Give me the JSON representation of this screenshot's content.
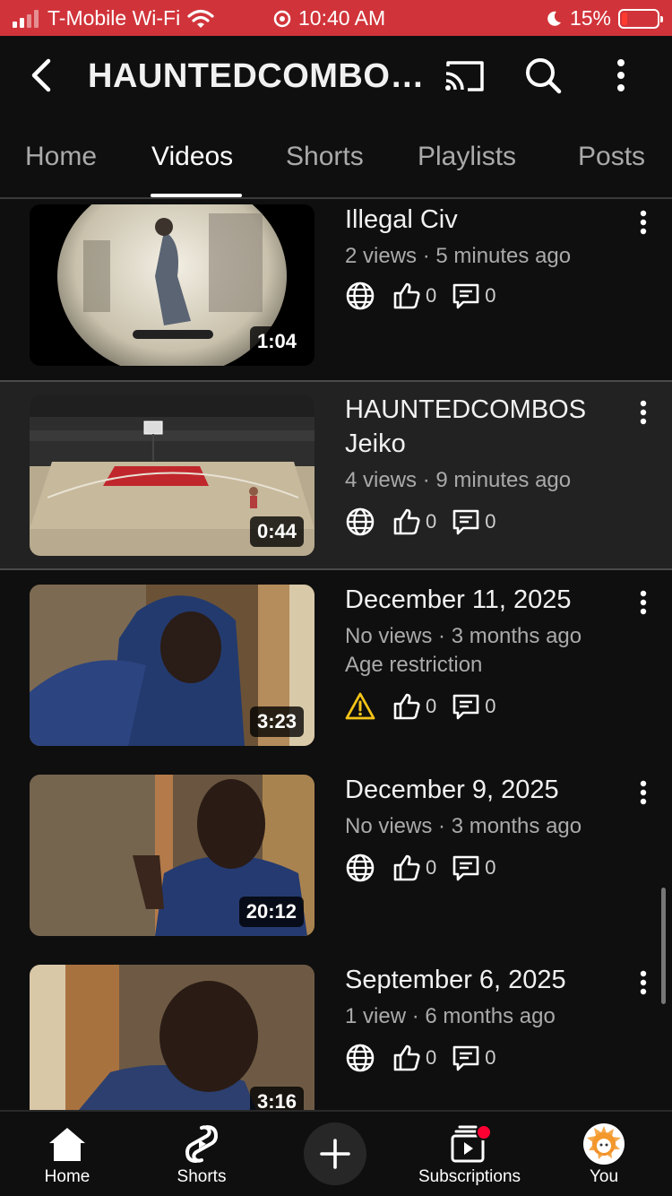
{
  "status_bar": {
    "carrier": "T-Mobile Wi-Fi",
    "time": "10:40 AM",
    "battery": "15%",
    "battery_level": 0.15,
    "bg_color": "#d0343a"
  },
  "appbar": {
    "title": "HAUNTEDCOMBO…",
    "icons": [
      "back-icon",
      "cast-icon",
      "search-icon",
      "more-icon"
    ]
  },
  "tabs": [
    {
      "label": "Home",
      "active": false
    },
    {
      "label": "Videos",
      "active": true
    },
    {
      "label": "Shorts",
      "active": false
    },
    {
      "label": "Playlists",
      "active": false
    },
    {
      "label": "Posts",
      "active": false
    }
  ],
  "videos": [
    {
      "title": "Illegal Civ",
      "meta": "2 views · 5 minutes ago",
      "extra": "",
      "duration": "1:04",
      "visibility": "public",
      "likes": "0",
      "comments": "0"
    },
    {
      "title": "HAUNTEDCOMBOS Jeiko",
      "meta": "4 views · 9 minutes ago",
      "extra": "",
      "duration": "0:44",
      "visibility": "public",
      "likes": "0",
      "comments": "0"
    },
    {
      "title": "December 11, 2025",
      "meta": "No views · 3 months ago",
      "extra": "Age restriction",
      "duration": "3:23",
      "visibility": "warning",
      "likes": "0",
      "comments": "0"
    },
    {
      "title": "December 9, 2025",
      "meta": "No views · 3 months ago",
      "extra": "",
      "duration": "20:12",
      "visibility": "public",
      "likes": "0",
      "comments": "0"
    },
    {
      "title": "September 6, 2025",
      "meta": "1 view · 6 months ago",
      "extra": "",
      "duration": "3:16",
      "visibility": "public",
      "likes": "0",
      "comments": "0"
    }
  ],
  "bottom_nav": [
    {
      "label": "Home",
      "icon": "home-icon"
    },
    {
      "label": "Shorts",
      "icon": "shorts-icon"
    },
    {
      "label": "",
      "icon": "create-icon"
    },
    {
      "label": "Subscriptions",
      "icon": "subscriptions-icon"
    },
    {
      "label": "You",
      "icon": "avatar"
    }
  ],
  "colors": {
    "warning": "#f5c518",
    "notification": "#ff0033"
  }
}
